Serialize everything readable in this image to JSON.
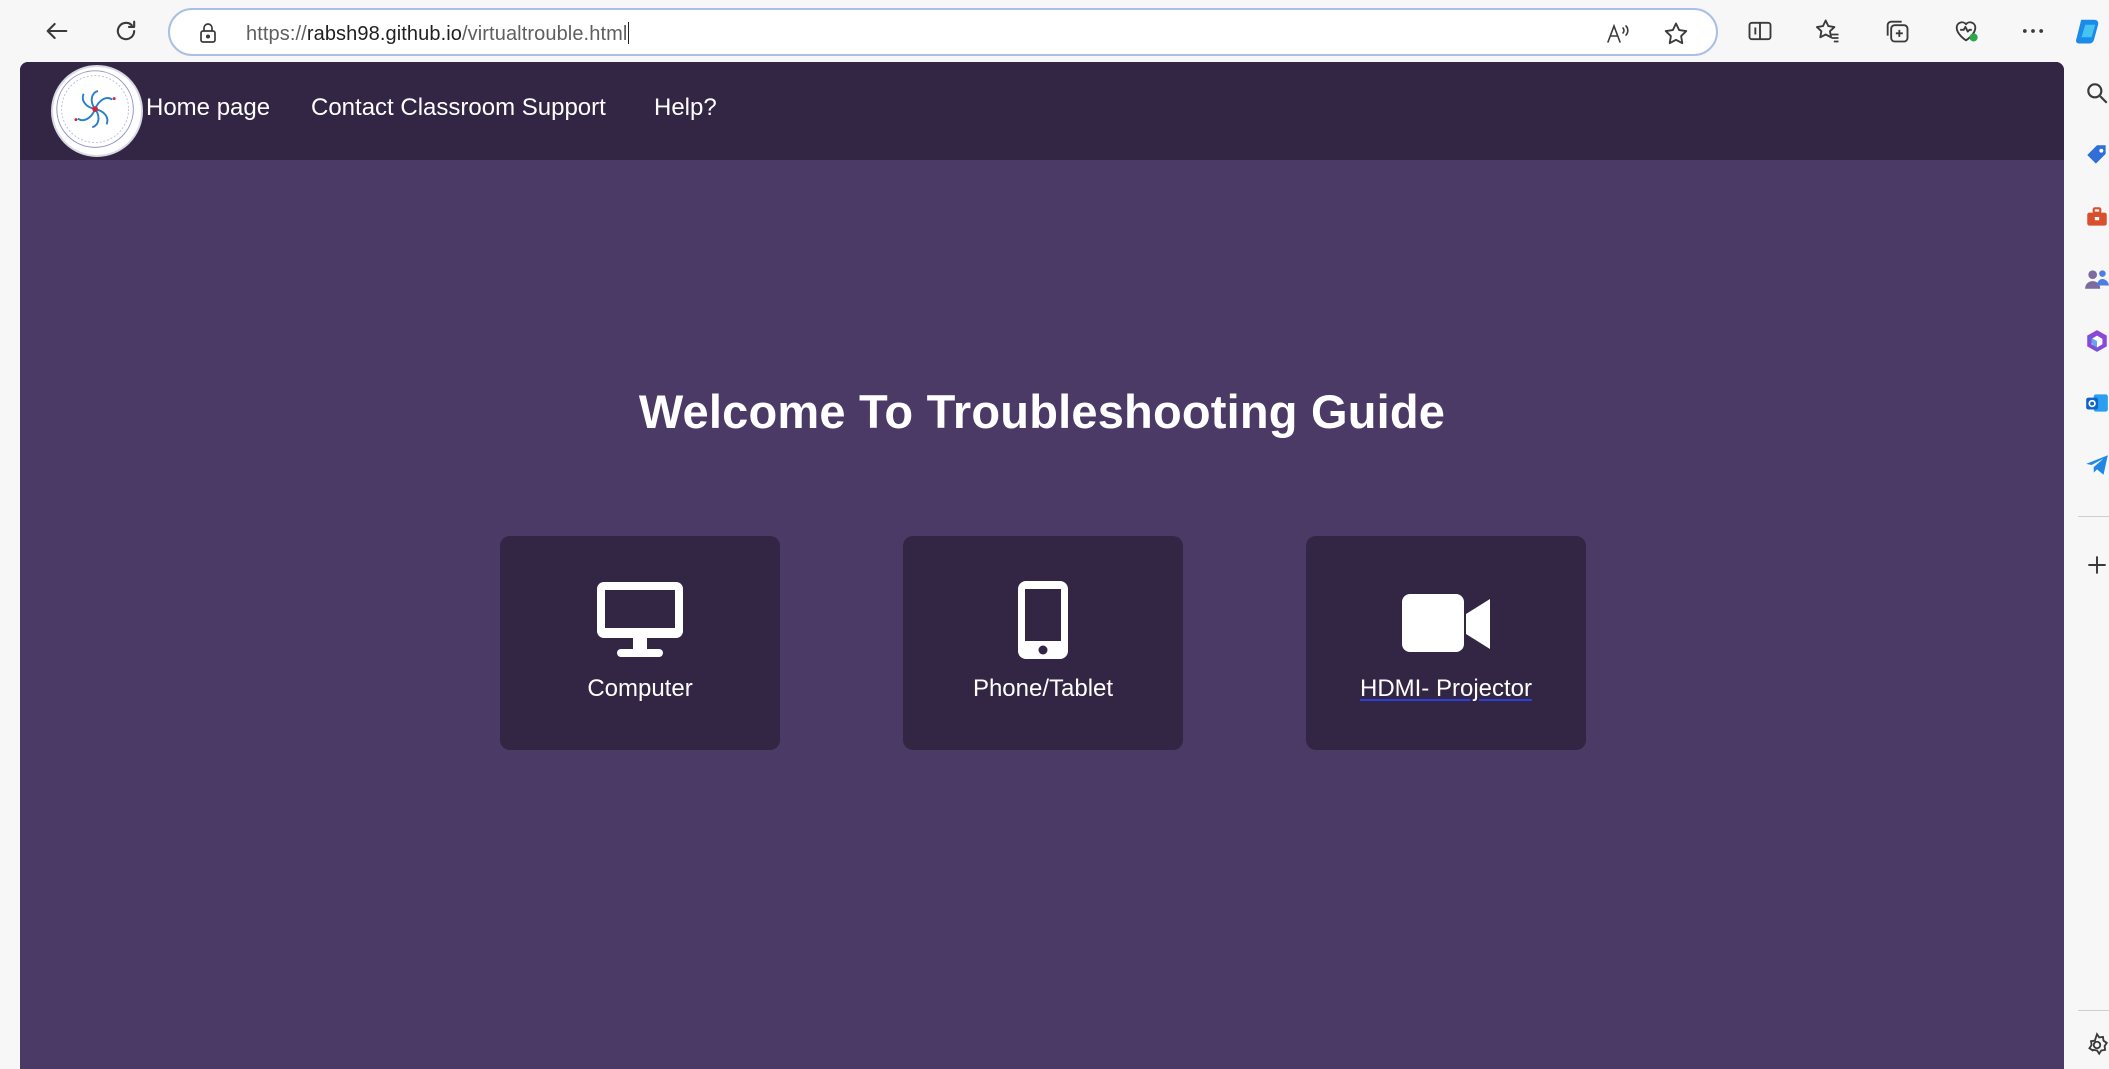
{
  "browser": {
    "url_scheme": "https://",
    "url_host": "rabsh98.github.io",
    "url_path": "/virtualtrouble.html",
    "accent_color": "#a9bfe6"
  },
  "icons": {
    "toolbar": [
      "back-arrow-icon",
      "refresh-icon",
      "lock-icon",
      "read-aloud-icon",
      "favorite-star-icon",
      "split-screen-icon",
      "favorites-icon",
      "collections-icon",
      "browser-essentials-icon",
      "more-options-icon",
      "copilot-icon"
    ],
    "sidebar": [
      "search-icon",
      "shopping-tag-icon",
      "tools-icon",
      "people-icon",
      "microsoft365-icon",
      "outlook-icon",
      "telegram-icon",
      "add-icon",
      "settings-icon"
    ]
  },
  "page": {
    "background_color": "#4b3a66",
    "navbar_color": "#332644",
    "nav": {
      "home": "Home page",
      "contact": "Contact Classroom Support",
      "help": "Help?"
    },
    "title": "Welcome To Troubleshooting Guide",
    "cards": [
      {
        "label": "Computer",
        "icon": "desktop-monitor-icon"
      },
      {
        "label": "Phone/Tablet",
        "icon": "mobile-phone-icon"
      },
      {
        "label": "HDMI- Projector",
        "icon": "video-camera-icon"
      }
    ]
  }
}
